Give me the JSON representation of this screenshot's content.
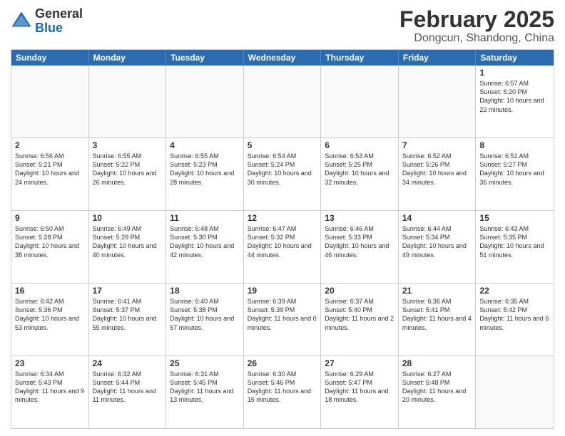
{
  "header": {
    "logo_general": "General",
    "logo_blue": "Blue",
    "month_title": "February 2025",
    "location": "Dongcun, Shandong, China"
  },
  "weekdays": [
    "Sunday",
    "Monday",
    "Tuesday",
    "Wednesday",
    "Thursday",
    "Friday",
    "Saturday"
  ],
  "rows": [
    {
      "cells": [
        {
          "empty": true
        },
        {
          "empty": true
        },
        {
          "empty": true
        },
        {
          "empty": true
        },
        {
          "empty": true
        },
        {
          "empty": true
        },
        {
          "day": 1,
          "info": "Sunrise: 6:57 AM\nSunset: 5:20 PM\nDaylight: 10 hours and 22 minutes."
        }
      ]
    },
    {
      "cells": [
        {
          "day": 2,
          "info": "Sunrise: 6:56 AM\nSunset: 5:21 PM\nDaylight: 10 hours and 24 minutes."
        },
        {
          "day": 3,
          "info": "Sunrise: 6:55 AM\nSunset: 5:22 PM\nDaylight: 10 hours and 26 minutes."
        },
        {
          "day": 4,
          "info": "Sunrise: 6:55 AM\nSunset: 5:23 PM\nDaylight: 10 hours and 28 minutes."
        },
        {
          "day": 5,
          "info": "Sunrise: 6:54 AM\nSunset: 5:24 PM\nDaylight: 10 hours and 30 minutes."
        },
        {
          "day": 6,
          "info": "Sunrise: 6:53 AM\nSunset: 5:25 PM\nDaylight: 10 hours and 32 minutes."
        },
        {
          "day": 7,
          "info": "Sunrise: 6:52 AM\nSunset: 5:26 PM\nDaylight: 10 hours and 34 minutes."
        },
        {
          "day": 8,
          "info": "Sunrise: 6:51 AM\nSunset: 5:27 PM\nDaylight: 10 hours and 36 minutes."
        }
      ]
    },
    {
      "cells": [
        {
          "day": 9,
          "info": "Sunrise: 6:50 AM\nSunset: 5:28 PM\nDaylight: 10 hours and 38 minutes."
        },
        {
          "day": 10,
          "info": "Sunrise: 6:49 AM\nSunset: 5:29 PM\nDaylight: 10 hours and 40 minutes."
        },
        {
          "day": 11,
          "info": "Sunrise: 6:48 AM\nSunset: 5:30 PM\nDaylight: 10 hours and 42 minutes."
        },
        {
          "day": 12,
          "info": "Sunrise: 6:47 AM\nSunset: 5:32 PM\nDaylight: 10 hours and 44 minutes."
        },
        {
          "day": 13,
          "info": "Sunrise: 6:46 AM\nSunset: 5:33 PM\nDaylight: 10 hours and 46 minutes."
        },
        {
          "day": 14,
          "info": "Sunrise: 6:44 AM\nSunset: 5:34 PM\nDaylight: 10 hours and 49 minutes."
        },
        {
          "day": 15,
          "info": "Sunrise: 6:43 AM\nSunset: 5:35 PM\nDaylight: 10 hours and 51 minutes."
        }
      ]
    },
    {
      "cells": [
        {
          "day": 16,
          "info": "Sunrise: 6:42 AM\nSunset: 5:36 PM\nDaylight: 10 hours and 53 minutes."
        },
        {
          "day": 17,
          "info": "Sunrise: 6:41 AM\nSunset: 5:37 PM\nDaylight: 10 hours and 55 minutes."
        },
        {
          "day": 18,
          "info": "Sunrise: 6:40 AM\nSunset: 5:38 PM\nDaylight: 10 hours and 57 minutes."
        },
        {
          "day": 19,
          "info": "Sunrise: 6:39 AM\nSunset: 5:39 PM\nDaylight: 11 hours and 0 minutes."
        },
        {
          "day": 20,
          "info": "Sunrise: 6:37 AM\nSunset: 5:40 PM\nDaylight: 11 hours and 2 minutes."
        },
        {
          "day": 21,
          "info": "Sunrise: 6:36 AM\nSunset: 5:41 PM\nDaylight: 11 hours and 4 minutes."
        },
        {
          "day": 22,
          "info": "Sunrise: 6:35 AM\nSunset: 5:42 PM\nDaylight: 11 hours and 6 minutes."
        }
      ]
    },
    {
      "cells": [
        {
          "day": 23,
          "info": "Sunrise: 6:34 AM\nSunset: 5:43 PM\nDaylight: 11 hours and 9 minutes."
        },
        {
          "day": 24,
          "info": "Sunrise: 6:32 AM\nSunset: 5:44 PM\nDaylight: 11 hours and 11 minutes."
        },
        {
          "day": 25,
          "info": "Sunrise: 6:31 AM\nSunset: 5:45 PM\nDaylight: 11 hours and 13 minutes."
        },
        {
          "day": 26,
          "info": "Sunrise: 6:30 AM\nSunset: 5:46 PM\nDaylight: 11 hours and 15 minutes."
        },
        {
          "day": 27,
          "info": "Sunrise: 6:29 AM\nSunset: 5:47 PM\nDaylight: 11 hours and 18 minutes."
        },
        {
          "day": 28,
          "info": "Sunrise: 6:27 AM\nSunset: 5:48 PM\nDaylight: 11 hours and 20 minutes."
        },
        {
          "empty": true
        }
      ]
    }
  ]
}
